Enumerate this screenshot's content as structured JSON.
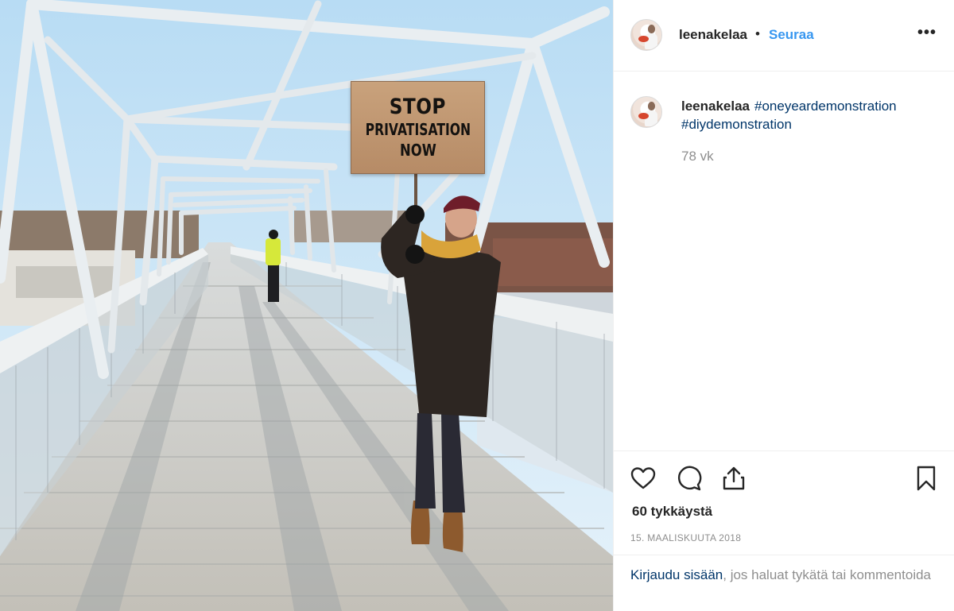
{
  "photo": {
    "sign_lines": [
      "STOP",
      "PRIVATISATION",
      "NOW"
    ]
  },
  "header": {
    "username": "leenakelaa",
    "separator": "•",
    "follow_label": "Seuraa",
    "more_label": "•••"
  },
  "caption": {
    "username": "leenakelaa",
    "hashtags": [
      "#oneyeardemonstration",
      "#diydemonstration"
    ],
    "age": "78 vk"
  },
  "actions": {
    "icons": [
      "heart-icon",
      "comment-icon",
      "share-icon",
      "bookmark-icon"
    ],
    "likes": "60 tykkäystä",
    "date": "15. MAALISKUUTA 2018"
  },
  "login": {
    "link_text": "Kirjaudu sisään",
    "rest_text": ", jos haluat tykätä tai kommentoida"
  },
  "colors": {
    "link_blue": "#3897f0",
    "hashtag_blue": "#003569",
    "muted_gray": "#8e8e8e",
    "divider": "#efefef"
  }
}
